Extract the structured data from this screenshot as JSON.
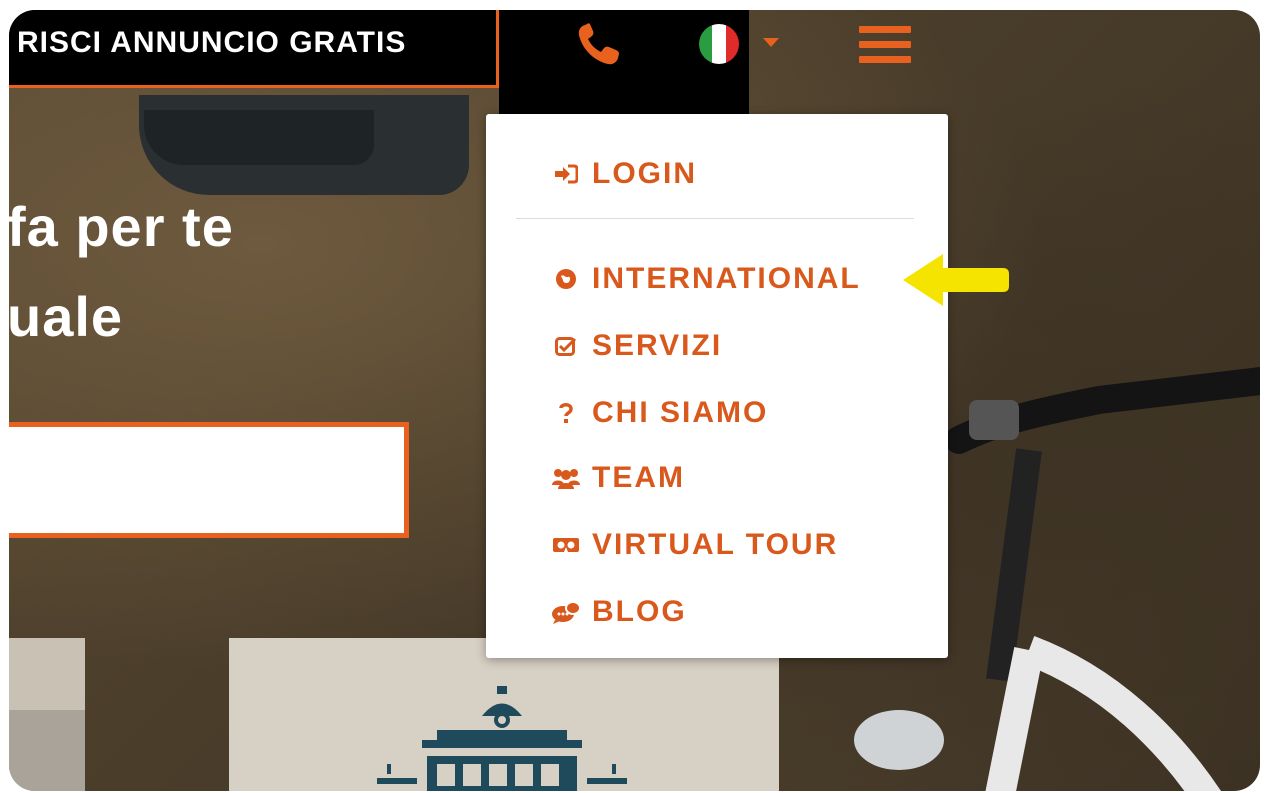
{
  "header": {
    "cta_label": "RISCI ANNUNCIO  GRATIS",
    "phone_icon": "phone-icon",
    "language_flag": "italy-flag-icon",
    "menu_icon": "hamburger-menu-icon"
  },
  "hero": {
    "line1": "fa per te",
    "line2": "uale"
  },
  "menu": {
    "login": "LOGIN",
    "items": [
      {
        "label": "INTERNATIONAL",
        "icon": "globe-icon"
      },
      {
        "label": "SERVIZI",
        "icon": "check-square-icon"
      },
      {
        "label": "CHI SIAMO",
        "icon": "question-icon"
      },
      {
        "label": "TEAM",
        "icon": "users-icon"
      },
      {
        "label": "VIRTUAL TOUR",
        "icon": "vr-headset-icon"
      },
      {
        "label": "BLOG",
        "icon": "chat-bubbles-icon"
      }
    ]
  },
  "colors": {
    "accent": "#e8611f",
    "menu_text": "#d9581c",
    "highlight_arrow": "#f5e400"
  }
}
